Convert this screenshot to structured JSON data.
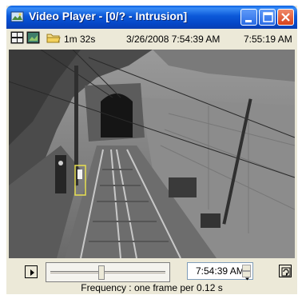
{
  "window": {
    "title": "Video Player - [0/? - Intrusion]"
  },
  "toolbar": {
    "duration": "1m 32s",
    "start_timestamp": "3/26/2008 7:54:39 AM",
    "current_time": "7:55:19 AM"
  },
  "controls": {
    "time_value": "7:54:39 AM",
    "playback_position": 0.44,
    "frequency_text": "Frequency : one frame per 0.12 s"
  },
  "colors": {
    "titlebar": "#0b58d8",
    "window_bg": "#ece9d8",
    "detection_box": "#e8e050"
  }
}
